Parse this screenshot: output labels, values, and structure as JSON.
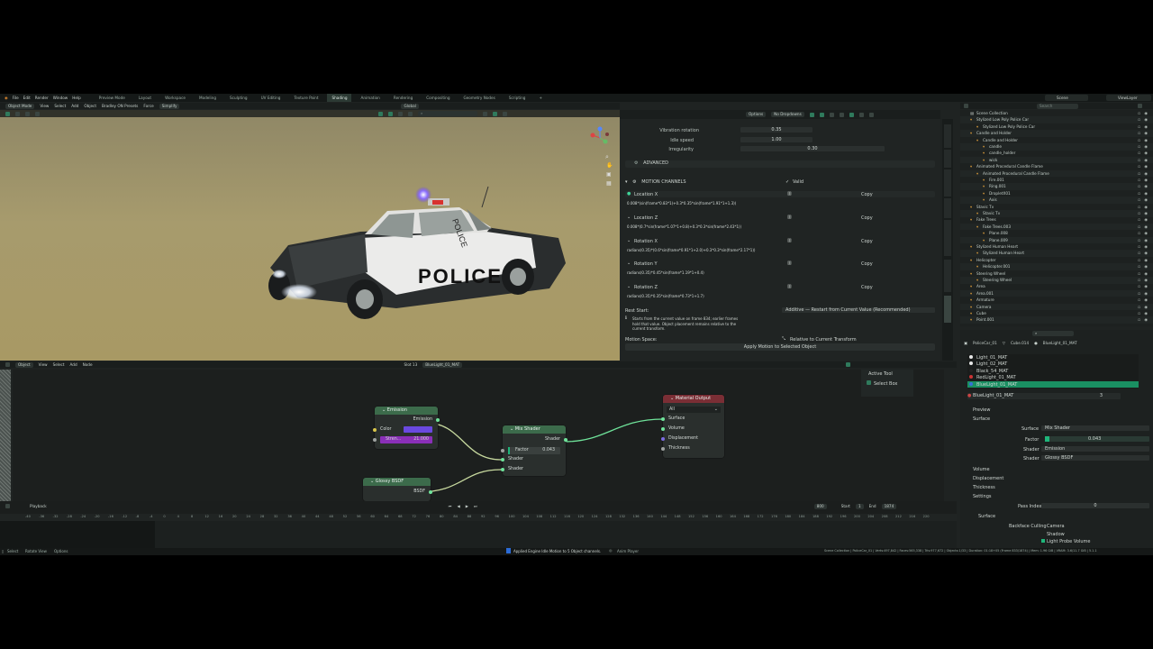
{
  "menu": [
    "File",
    "Edit",
    "Render",
    "Window",
    "Help"
  ],
  "workspaces": [
    "Preview Mode",
    "Layout",
    "Workspace",
    "Modeling",
    "Sculpting",
    "UV Editing",
    "Texture Paint",
    "Shading",
    "Animation",
    "Rendering",
    "Compositing",
    "Geometry Nodes",
    "Scripting"
  ],
  "active_workspace": "Shading",
  "scene": "Scene",
  "view_layer": "ViewLayer",
  "viewport_header": [
    "Object Mode",
    "View",
    "Select",
    "Add",
    "Object",
    "Bradley ON Presets",
    "Force",
    "Simplify"
  ],
  "transform_orient": "Global",
  "options_label": "Options",
  "dropdown_label": "No Dropdowns",
  "car_label": "POLICE",
  "car_roof_text": "POLICE",
  "props": {
    "vibration_rotation_label": "Vibration rotation",
    "vibration_rotation_value": "0.35",
    "idle_speed_label": "Idle speed",
    "idle_speed_value": "1.00",
    "irregularity_label": "Irregularity",
    "irregularity_value": "0.30",
    "advanced_label": "ADVANCED",
    "motion_channels_label": "MOTION CHANNELS",
    "valid_label": "Valid",
    "copy_label": "Copy",
    "channels": [
      {
        "label": "Location X",
        "expr": "0.008*(sin(frame*0.83*1)+0.3*0.35*sin(frame*1.91*1+1.3))"
      },
      {
        "label": "Location Z",
        "expr": "0.008*(0.7*sin(frame*1.07*1+0.8)+0.3*0.3*sin(frame*2.43*1))"
      },
      {
        "label": "Rotation X",
        "expr": "radians(0.35)*(0.6*sin(frame*0.91*1+2.0)+0.3*0.3*sin(frame*2.17*1))"
      },
      {
        "label": "Rotation Y",
        "expr": "radians(0.35)*0.45*sin(frame*1.19*1+0.4)"
      },
      {
        "label": "Rotation Z",
        "expr": "radians(0.35)*0.35*sin(frame*0.73*1+1.7)"
      }
    ],
    "rest_start_label": "Rest Start:",
    "rest_start_value": "Additive — Restart from Current Value (Recommended)",
    "info_text": "Starts from the current value on frame 834; earlier frames hold that value. Object placement remains relative to the current transform.",
    "motion_space_label": "Motion Space:",
    "motion_space_value": "Relative to Current Transform",
    "apply_button": "Apply Motion to Selected Object"
  },
  "outliner": {
    "search_placeholder": "Search",
    "rows": [
      "Scene Collection",
      "Stylized Low Poly Police Car",
      "Stylized Low Poly Police Car",
      "Candle and Holder",
      "Candle and Holder",
      "candle",
      "candle_holder",
      "wick",
      "Animated Procedural Candle Flame",
      "Animated Procedural Candle Flame",
      "Fire.001",
      "Ring.001",
      "DropletX01",
      "Axis",
      "Stavic Tv",
      "Stavic Tv",
      "Fake Trees",
      "Fake Trees.003",
      "Plane.008",
      "Plane.009",
      "Stylized Human Heart",
      "Stylized Human Heart",
      "Helicopter",
      "Helicopter.001",
      "Steering Wheel",
      "Steering Wheel",
      "Area",
      "Area.001",
      "Armature",
      "Camera",
      "Cube",
      "Point.001"
    ]
  },
  "material_props": {
    "object": "PoliceCar_01",
    "mesh": "Cube.014",
    "material": "BlueLight_01_MAT",
    "slots": [
      "Light_01_MAT",
      "Light_02_MAT",
      "Black_54_MAT",
      "RedLight_01_MAT",
      "BlueLight_01_MAT"
    ],
    "active_slot": "BlueLight_01_MAT",
    "users": "3",
    "preview_label": "Preview",
    "surface_label": "Surface",
    "surface_value": "Mix Shader",
    "factor_label": "Factor",
    "factor_value": "0.043",
    "shader1_label": "Shader",
    "shader1_value": "Emission",
    "shader2_label": "Shader",
    "shader2_value": "Glossy BSDF",
    "volume_label": "Volume",
    "displacement_label": "Displacement",
    "thickness_label": "Thickness",
    "settings_label": "Settings",
    "pass_index_label": "Pass Index",
    "pass_index_value": "0",
    "surface2_label": "Surface",
    "backface_label": "Backface Culling",
    "camera_label": "Camera",
    "shadow_label": "Shadow",
    "light_probe_label": "Light Probe Volume"
  },
  "node_header": {
    "editor": [
      "View",
      "Select",
      "Add",
      "Node"
    ],
    "mode": "Object",
    "slot": "Slot 13",
    "material": "BlueLight_01_MAT",
    "breadcrumb": [
      "PoliceCar_01",
      "Cube.014",
      "BlueLight_01_MAT"
    ],
    "active_tool": "Active Tool",
    "select_box": "Select Box"
  },
  "nodes": {
    "emission": {
      "title": "Emission",
      "out": "Emission",
      "color_label": "Color",
      "strength_label": "Stren...",
      "strength_value": "21.000"
    },
    "glossy": {
      "title": "Glossy BSDF",
      "out": "BSDF"
    },
    "mix": {
      "title": "Mix Shader",
      "out": "Shader",
      "factor_label": "Factor",
      "factor_value": "0.043",
      "in1": "Shader",
      "in2": "Shader"
    },
    "output": {
      "title": "Material Output",
      "target": "All",
      "inputs": [
        "Surface",
        "Volume",
        "Displacement",
        "Thickness"
      ]
    }
  },
  "timeline": {
    "playback": "Playback",
    "current_frame": "800",
    "start_label": "Start",
    "start_value": "1",
    "end_label": "End",
    "end_value": "1874",
    "ticks": [
      "-40",
      "-36",
      "-32",
      "-28",
      "-24",
      "-20",
      "-16",
      "-12",
      "-8",
      "-4",
      "0",
      "4",
      "8",
      "12",
      "16",
      "20",
      "24",
      "28",
      "32",
      "36",
      "40",
      "44",
      "48",
      "52",
      "56",
      "60",
      "64",
      "68",
      "72",
      "76",
      "80",
      "84",
      "88",
      "92",
      "96",
      "100",
      "104",
      "108",
      "112",
      "116",
      "120",
      "124",
      "128",
      "132",
      "136",
      "140",
      "144",
      "148",
      "152",
      "156",
      "160",
      "164",
      "168",
      "172",
      "176",
      "180",
      "184",
      "188",
      "192",
      "196",
      "200",
      "204",
      "208",
      "212",
      "216",
      "220"
    ]
  },
  "status": {
    "left": [
      "Select",
      "Rotate View",
      "Options"
    ],
    "message": "Applied Engine Idle Motion to 5 Object channels.",
    "anim_player": "Anim Player",
    "right": "Scene Collection | PoliceCar_01 | Verts:497,842 | Faces:565,338 | Tris:977,672 | Objects:1/33 | Duration: 01:18+05 (Frame 833/1874) | Mem: 1.96 GiB | VRAM: 3.6/11.7 GiB | 5.1.1"
  },
  "colors": {
    "accent": "#1fb57a",
    "selected": "#1a8f62",
    "emission": "#6a49e0",
    "strength": "#8a2fb8"
  }
}
